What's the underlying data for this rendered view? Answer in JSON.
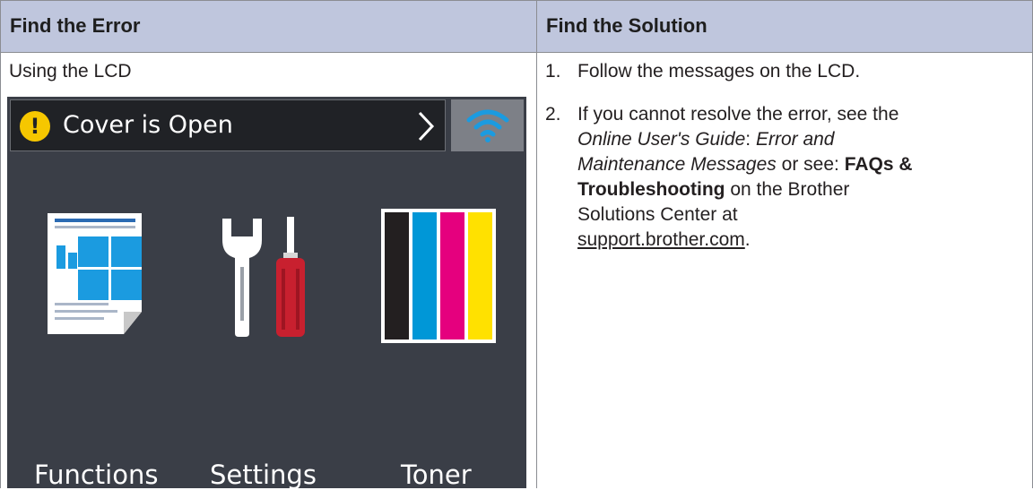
{
  "table": {
    "header_left": "Find the Error",
    "header_right": "Find the Solution"
  },
  "left": {
    "caption": "Using the LCD"
  },
  "lcd": {
    "status_message": "Cover is Open",
    "warning_glyph": "!",
    "icons": {
      "status": "warning-icon",
      "next": "chevron-right-icon",
      "wifi": "wifi-icon",
      "functions": "functions-icon",
      "settings": "settings-icon",
      "toner": "toner-icon"
    },
    "buttons": {
      "functions": "Functions",
      "settings": "Settings",
      "toner": "Toner"
    },
    "colors": {
      "background": "#3a3e47",
      "statusbar": "#202226",
      "wifi_button": "#7d8087",
      "wifi_icon": "#1b9be0",
      "warning": "#f6c700",
      "toner_black": "#231f20",
      "toner_cyan": "#0097d7",
      "toner_magenta": "#e5007e",
      "toner_yellow": "#ffe100"
    }
  },
  "solution": {
    "step1_num": "1.",
    "step1_text": "Follow the messages on the LCD.",
    "step2_num": "2.",
    "step2_part1": "If you cannot resolve the error, see the",
    "step2_guide": "Online User's Guide",
    "step2_colon": ":",
    "step2_topic_a": "Error and",
    "step2_topic_b": "Maintenance Messages",
    "step2_or": "or see:",
    "step2_faq_a": "FAQs &",
    "step2_faq_b": "Troubleshooting",
    "step2_on": "on the Brother",
    "step2_center": "Solutions Center at",
    "step2_link": "support.brother.com",
    "step2_end": "."
  }
}
